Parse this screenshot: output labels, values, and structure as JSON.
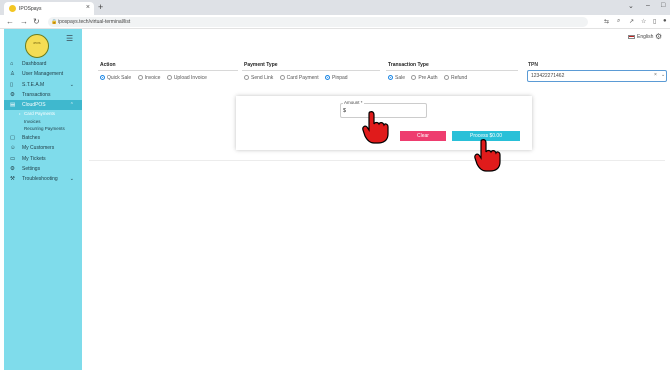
{
  "browser": {
    "tab_title": "IPOSpays",
    "url": "ipospays.tech/virtual-terminal/list"
  },
  "sidebar": {
    "logo_text": "iPOS",
    "items": [
      {
        "label": "Dashboard",
        "icon": "home-icon"
      },
      {
        "label": "User Management",
        "icon": "user-icon"
      },
      {
        "label": "S.T.E.A.M",
        "icon": "phone-icon",
        "chevron": true
      },
      {
        "label": "Transactions",
        "icon": "settings-icon"
      },
      {
        "label": "CloudPOS",
        "icon": "pos-icon",
        "active": true,
        "chevron": true
      },
      {
        "label": "Batches",
        "icon": "file-icon"
      },
      {
        "label": "My Customers",
        "icon": "person-icon"
      },
      {
        "label": "My Tickets",
        "icon": "ticket-icon"
      },
      {
        "label": "Settings",
        "icon": "gear-icon"
      },
      {
        "label": "Troubleshooting",
        "icon": "wrench-icon",
        "chevron": true
      }
    ],
    "subitems": [
      {
        "label": "Card Payments",
        "current": true
      },
      {
        "label": "Invoices"
      },
      {
        "label": "Recurring Payments"
      }
    ]
  },
  "header": {
    "language": "English"
  },
  "form": {
    "action": {
      "label": "Action",
      "options": [
        "Quick Sale",
        "Invoice",
        "Upload Invoice"
      ],
      "selected": "Quick Sale"
    },
    "payment_type": {
      "label": "Payment Type",
      "options": [
        "Send Link",
        "Card Payment",
        "Pinpad"
      ],
      "selected": "Pinpad"
    },
    "transaction_type": {
      "label": "Transaction Type",
      "options": [
        "Sale",
        "Pre Auth",
        "Refund"
      ],
      "selected": "Sale"
    },
    "tpn": {
      "label": "TPN",
      "value": "123422271462"
    }
  },
  "payment_card": {
    "amount_label": "Amount *",
    "amount_value": "$",
    "clear_label": "Clear",
    "process_label": "Process $0.00"
  },
  "colors": {
    "sidebar_bg": "#7fdceb",
    "active_item": "#3fb8ce",
    "clear_btn": "#ee3d6f",
    "process_btn": "#29c0d8"
  }
}
